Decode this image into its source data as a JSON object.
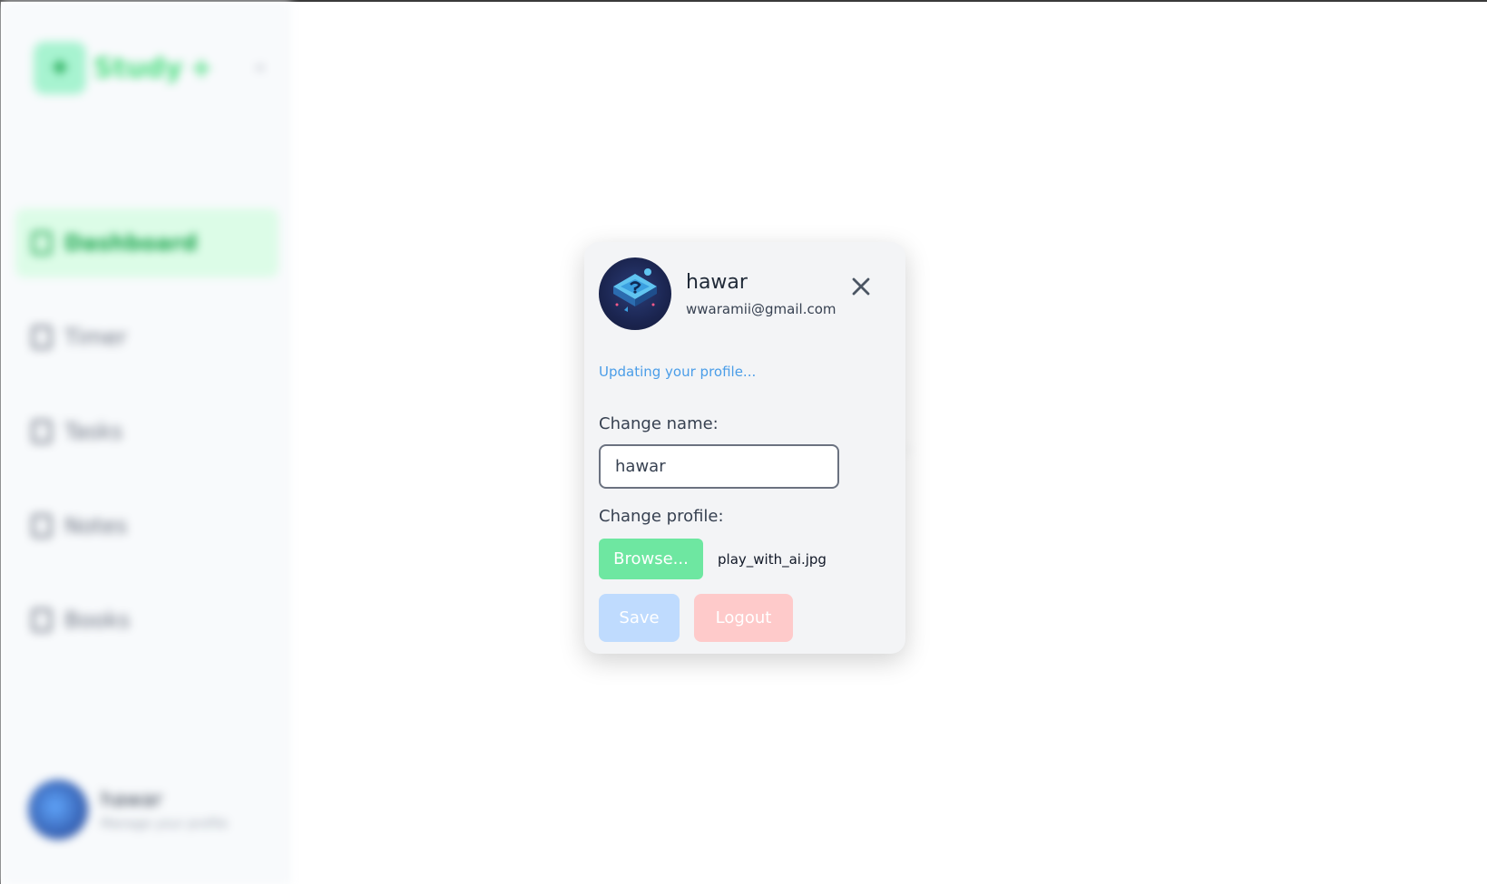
{
  "background": {
    "brand_name": "Study",
    "brand_badge": "+",
    "nav_items": [
      {
        "label": "Dashboard",
        "icon": "dashboard-icon"
      },
      {
        "label": "Timer",
        "icon": "timer-icon"
      },
      {
        "label": "Tasks",
        "icon": "tasks-icon"
      },
      {
        "label": "Notes",
        "icon": "notes-icon"
      },
      {
        "label": "Books",
        "icon": "books-icon"
      }
    ],
    "user_name": "hawar",
    "user_sub": "Manage your profile"
  },
  "modal": {
    "name": "hawar",
    "email": "wwaramii@gmail.com",
    "status": "Updating your profile...",
    "change_name_label": "Change name:",
    "name_value": "hawar",
    "change_profile_label": "Change profile:",
    "browse_label": "Browse...",
    "file_name": "play_with_ai.jpg",
    "save_label": "Save",
    "logout_label": "Logout"
  },
  "colors": {
    "accent_green": "#6ee7a1",
    "status_blue": "#4a9de8",
    "save_disabled": "#bfdbfe",
    "logout_disabled": "#fecaca"
  }
}
